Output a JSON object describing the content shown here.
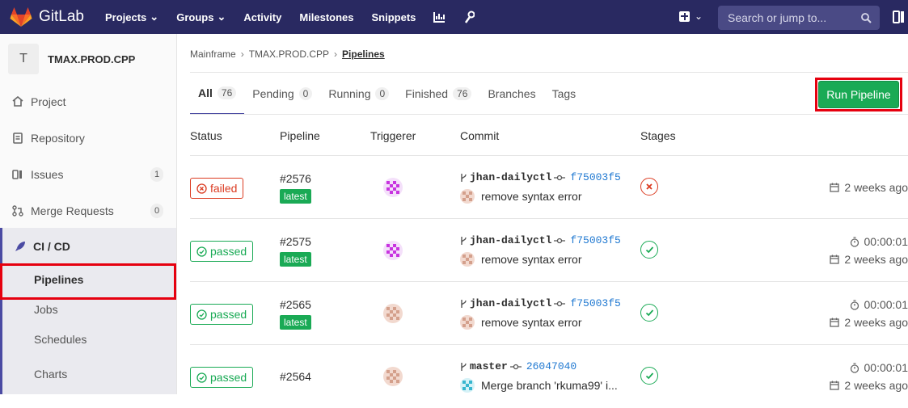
{
  "navbar": {
    "brand": "GitLab",
    "links": [
      "Projects",
      "Groups",
      "Activity",
      "Milestones",
      "Snippets"
    ],
    "search_placeholder": "Search or jump to..."
  },
  "sidebar": {
    "project_initial": "T",
    "project_name": "TMAX.PROD.CPP",
    "items": [
      {
        "label": "Project",
        "icon": "home-icon"
      },
      {
        "label": "Repository",
        "icon": "repository-icon"
      },
      {
        "label": "Issues",
        "icon": "issues-icon",
        "count": "1"
      },
      {
        "label": "Merge Requests",
        "icon": "merge-request-icon",
        "count": "0"
      },
      {
        "label": "CI / CD",
        "icon": "rocket-icon"
      }
    ],
    "sub_items": [
      "Pipelines",
      "Jobs",
      "Schedules",
      "Charts"
    ]
  },
  "breadcrumb": [
    "Mainframe",
    "TMAX.PROD.CPP",
    "Pipelines"
  ],
  "tabs": [
    {
      "label": "All",
      "count": "76"
    },
    {
      "label": "Pending",
      "count": "0"
    },
    {
      "label": "Running",
      "count": "0"
    },
    {
      "label": "Finished",
      "count": "76"
    },
    {
      "label": "Branches"
    },
    {
      "label": "Tags"
    }
  ],
  "run_pipeline_label": "Run Pipeline",
  "columns": [
    "Status",
    "Pipeline",
    "Triggerer",
    "Commit",
    "Stages"
  ],
  "pipelines": [
    {
      "status": "failed",
      "id": "#2576",
      "latest": "latest",
      "branch": "jhan-dailyctl",
      "sha": "f75003f5",
      "message": "remove syntax error",
      "duration": "",
      "finished": "2 weeks ago"
    },
    {
      "status": "passed",
      "id": "#2575",
      "latest": "latest",
      "branch": "jhan-dailyctl",
      "sha": "f75003f5",
      "message": "remove syntax error",
      "duration": "00:00:01",
      "finished": "2 weeks ago"
    },
    {
      "status": "passed",
      "id": "#2565",
      "latest": "latest",
      "branch": "jhan-dailyctl",
      "sha": "f75003f5",
      "message": "remove syntax error",
      "duration": "00:00:01",
      "finished": "2 weeks ago"
    },
    {
      "status": "passed",
      "id": "#2564",
      "latest": "",
      "branch": "master",
      "sha": "26047040",
      "message": "Merge branch 'rkuma99' i...",
      "duration": "00:00:01",
      "finished": "2 weeks ago"
    }
  ],
  "colors": {
    "navbar": "#292961",
    "success": "#1aaa55",
    "danger": "#db3b21",
    "link": "#1f78d1",
    "highlight": "#e6000f"
  }
}
